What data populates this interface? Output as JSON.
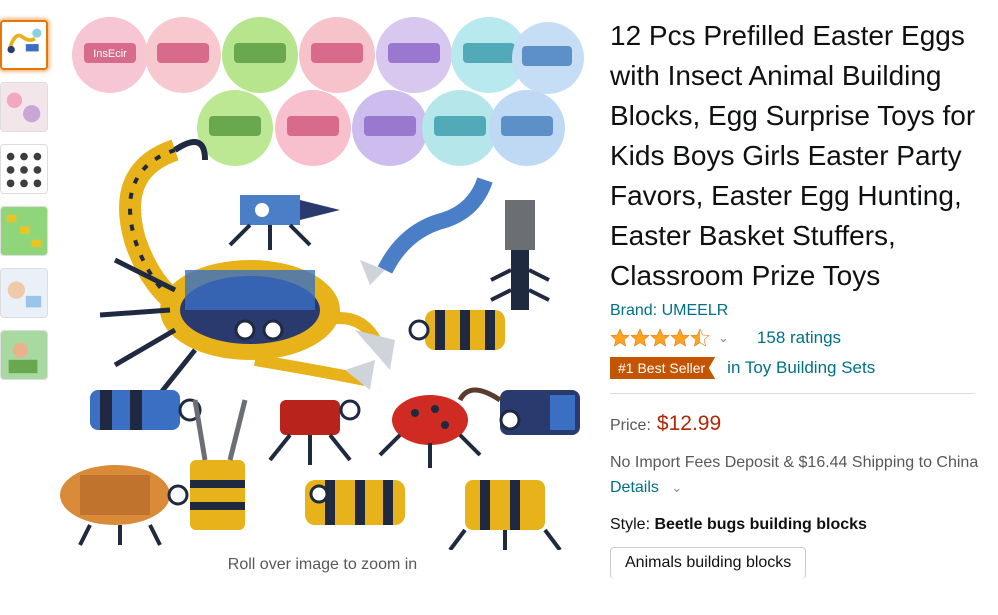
{
  "thumbnails": [
    {
      "name": "thumbnail-1",
      "selected": true
    },
    {
      "name": "thumbnail-2",
      "selected": false
    },
    {
      "name": "thumbnail-3",
      "selected": false
    },
    {
      "name": "thumbnail-4",
      "selected": false
    },
    {
      "name": "thumbnail-5",
      "selected": false
    },
    {
      "name": "thumbnail-6",
      "selected": false
    }
  ],
  "image": {
    "zoom_hint": "Roll over image to zoom in",
    "egg_capsule_text": "InsEcir"
  },
  "product": {
    "title": "12 Pcs Prefilled Easter Eggs with Insect Animal Building Blocks, Egg Surprise Toys for Kids Boys Girls Easter Party Favors, Easter Egg Hunting, Easter Basket Stuffers, Classroom Prize Toys",
    "brand": "Brand: UMEELR",
    "ratings_count": "158 ratings",
    "star_rating": 4.5,
    "badge": "#1 Best Seller",
    "badge_category": "in Toy Building Sets",
    "price_label": "Price:",
    "price": "$12.99",
    "shipping": "No Import Fees Deposit & $16.44 Shipping to China",
    "details_link": "Details",
    "style_label": "Style:",
    "style_value": "Beetle bugs building blocks",
    "style_option": "Animals building blocks"
  },
  "colors": {
    "link": "#007185",
    "price": "#b12704",
    "badge": "#c45500",
    "star": "#ffa41c"
  }
}
